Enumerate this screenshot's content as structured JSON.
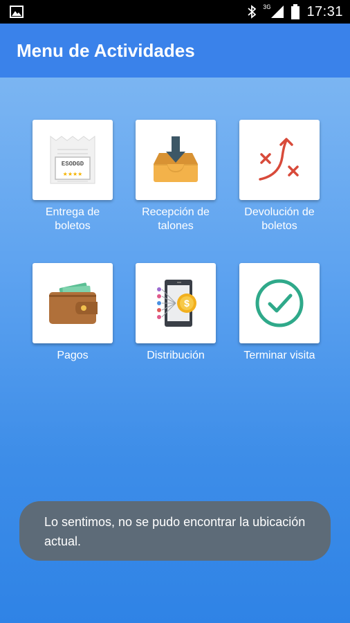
{
  "status_bar": {
    "network": "3G",
    "time": "17:31"
  },
  "appbar": {
    "title": "Menu de Actividades"
  },
  "tiles": [
    {
      "label_line1": "Entrega de",
      "label_line2": "boletos",
      "icon": "ticket-icon"
    },
    {
      "label_line1": "Recepción de",
      "label_line2": "talones",
      "icon": "inbox-tray-icon"
    },
    {
      "label_line1": "Devolución de",
      "label_line2": "boletos",
      "icon": "strategy-arrow-icon"
    },
    {
      "label_line1": "Pagos",
      "label_line2": "",
      "icon": "wallet-icon"
    },
    {
      "label_line1": "Distribución",
      "label_line2": "",
      "icon": "distribution-phone-icon"
    },
    {
      "label_line1": "Terminar visita",
      "label_line2": "",
      "icon": "check-circle-icon"
    }
  ],
  "ticket": {
    "code": "ESODGD",
    "stars": "★★★★"
  },
  "toast": {
    "message": "Lo sentimos, no se pudo encontrar la ubicación actual."
  }
}
